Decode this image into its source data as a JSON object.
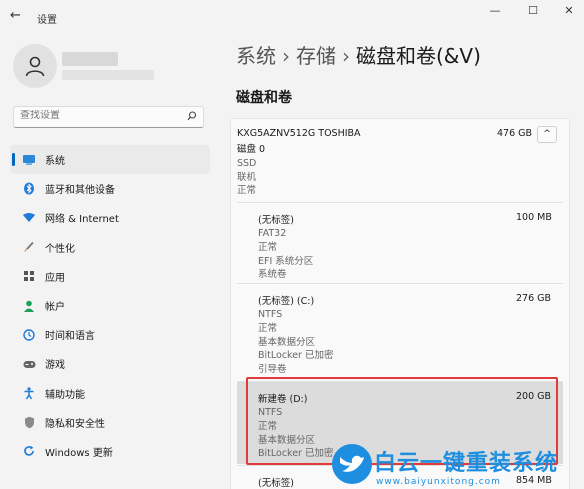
{
  "window": {
    "title": "设置",
    "back_icon": "←",
    "minimize": "—",
    "maximize": "☐",
    "close": "✕"
  },
  "search": {
    "placeholder": "查找设置",
    "icon": "search-icon"
  },
  "sidebar": {
    "items": [
      {
        "label": "系统",
        "icon": "monitor-icon",
        "active": true,
        "color": "#0067c0"
      },
      {
        "label": "蓝牙和其他设备",
        "icon": "bluetooth-icon",
        "color": "#0067c0"
      },
      {
        "label": "网络 & Internet",
        "icon": "wifi-icon",
        "color": "#0067c0"
      },
      {
        "label": "个性化",
        "icon": "brush-icon",
        "color": "#e07a3a"
      },
      {
        "label": "应用",
        "icon": "apps-icon",
        "color": "#555555"
      },
      {
        "label": "帐户",
        "icon": "person-icon",
        "color": "#1aa05a"
      },
      {
        "label": "时间和语言",
        "icon": "globe-clock-icon",
        "color": "#0067c0"
      },
      {
        "label": "游戏",
        "icon": "gamepad-icon",
        "color": "#666666"
      },
      {
        "label": "辅助功能",
        "icon": "accessibility-icon",
        "color": "#0067c0"
      },
      {
        "label": "隐私和安全性",
        "icon": "shield-icon",
        "color": "#777777"
      },
      {
        "label": "Windows 更新",
        "icon": "update-icon",
        "color": "#0067c0"
      }
    ]
  },
  "breadcrumb": {
    "part1": "系统",
    "part2": "存储",
    "current": "磁盘和卷(&V)",
    "separator": "›"
  },
  "section_title": "磁盘和卷",
  "disk": {
    "name": "KXG5AZNV512G TOSHIBA",
    "size": "476 GB",
    "lines": [
      "磁盘 0",
      "SSD",
      "联机",
      "正常"
    ],
    "collapse_icon": "^"
  },
  "volumes": [
    {
      "name": "(无标签)",
      "size": "100 MB",
      "details": [
        "FAT32",
        "正常",
        "EFI 系统分区",
        "系统卷"
      ]
    },
    {
      "name": "(无标签) (C:)",
      "size": "276 GB",
      "details": [
        "NTFS",
        "正常",
        "基本数据分区",
        "BitLocker 已加密",
        "引导卷"
      ]
    },
    {
      "name": "新建卷 (D:)",
      "size": "200 GB",
      "details": [
        "NTFS",
        "正常",
        "基本数据分区",
        "BitLocker 已加密"
      ],
      "highlight": true
    },
    {
      "name": "(无标签)",
      "size": "854 MB",
      "details": []
    }
  ],
  "watermark": {
    "text": "白云一键重装系统",
    "url": "www.baiyunxitong.com"
  }
}
